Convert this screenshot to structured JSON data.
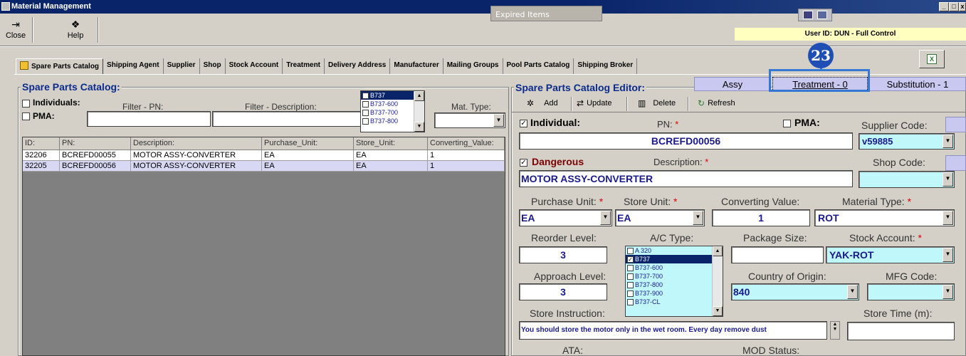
{
  "window": {
    "title": "Material Management",
    "expired_items_label": "Expired Items",
    "controls": [
      "_",
      "□",
      "x"
    ]
  },
  "toolbar": {
    "close_label": "Close",
    "help_label": "Help"
  },
  "user_info": "User ID: DUN - Full Control",
  "callout_number": "23",
  "tabs": [
    "Spare Parts Catalog",
    "Shipping Agent",
    "Supplier",
    "Shop",
    "Stock Account",
    "Treatment",
    "Delivery Address",
    "Manufacturer",
    "Mailing Groups",
    "Pool Parts Catalog",
    "Shipping Broker"
  ],
  "catalog": {
    "title": "Spare Parts Catalog:",
    "individuals_label": "Individuals:",
    "pma_label": "PMA:",
    "filter_pn_label": "Filter - PN:",
    "filter_desc_label": "Filter - Description:",
    "mat_type_label": "Mat. Type:",
    "filter_pn_value": "",
    "filter_desc_value": "",
    "mat_type_value": "",
    "ac_list": [
      "B737",
      "B737-600",
      "B737-700",
      "B737-800"
    ],
    "columns": [
      "ID:",
      "PN:",
      "Description:",
      "Purchase_Unit:",
      "Store_Unit:",
      "Converting_Value:"
    ],
    "rows": [
      [
        "32206",
        "BCREFD00055",
        "MOTOR ASSY-CONVERTER",
        "EA",
        "EA",
        "1"
      ],
      [
        "32205",
        "BCREFD00056",
        "MOTOR ASSY-CONVERTER",
        "EA",
        "EA",
        "1"
      ]
    ]
  },
  "editor": {
    "title": "Spare Parts Catalog Editor:",
    "tabs": [
      "Assy",
      "Treatment - 0",
      "Substitution - 1"
    ],
    "actions": {
      "add": "Add",
      "update": "Update",
      "delete": "Delete",
      "refresh": "Refresh"
    },
    "individual_label": "Individual:",
    "pn_label": "PN:",
    "pma_label": "PMA:",
    "supplier_code_label": "Supplier Code:",
    "pn_value": "BCREFD00056",
    "supplier_code_value": "v59885",
    "dangerous_label": "Dangerous",
    "description_label": "Description:",
    "shop_code_label": "Shop Code:",
    "description_value": "MOTOR ASSY-CONVERTER",
    "shop_code_value": "",
    "purchase_unit_label": "Purchase Unit:",
    "store_unit_label": "Store Unit:",
    "converting_value_label": "Converting Value:",
    "material_type_label": "Material Type:",
    "purchase_unit_value": "EA",
    "store_unit_value": "EA",
    "converting_value": "1",
    "material_type_value": "ROT",
    "reorder_level_label": "Reorder Level:",
    "ac_type_label": "A/C Type:",
    "package_size_label": "Package Size:",
    "stock_account_label": "Stock Account:",
    "reorder_level_value": "3",
    "package_size_value": "",
    "stock_account_value": "YAK-ROT",
    "approach_level_label": "Approach Level:",
    "country_label": "Country of Origin:",
    "mfg_code_label": "MFG Code:",
    "approach_level_value": "3",
    "country_value": "840",
    "mfg_code_value": "",
    "store_instruction_label": "Store Instruction:",
    "store_time_label": "Store Time (m):",
    "store_instruction_value": "You should store the motor only in the wet room. Every day remove dust",
    "store_time_value": "",
    "ac_types": [
      "A 320",
      "B737",
      "B737-600",
      "B737-700",
      "B737-800",
      "B737-900",
      "B737-CL"
    ],
    "ata_label": "ATA:",
    "mod_status_label": "MOD Status:"
  }
}
